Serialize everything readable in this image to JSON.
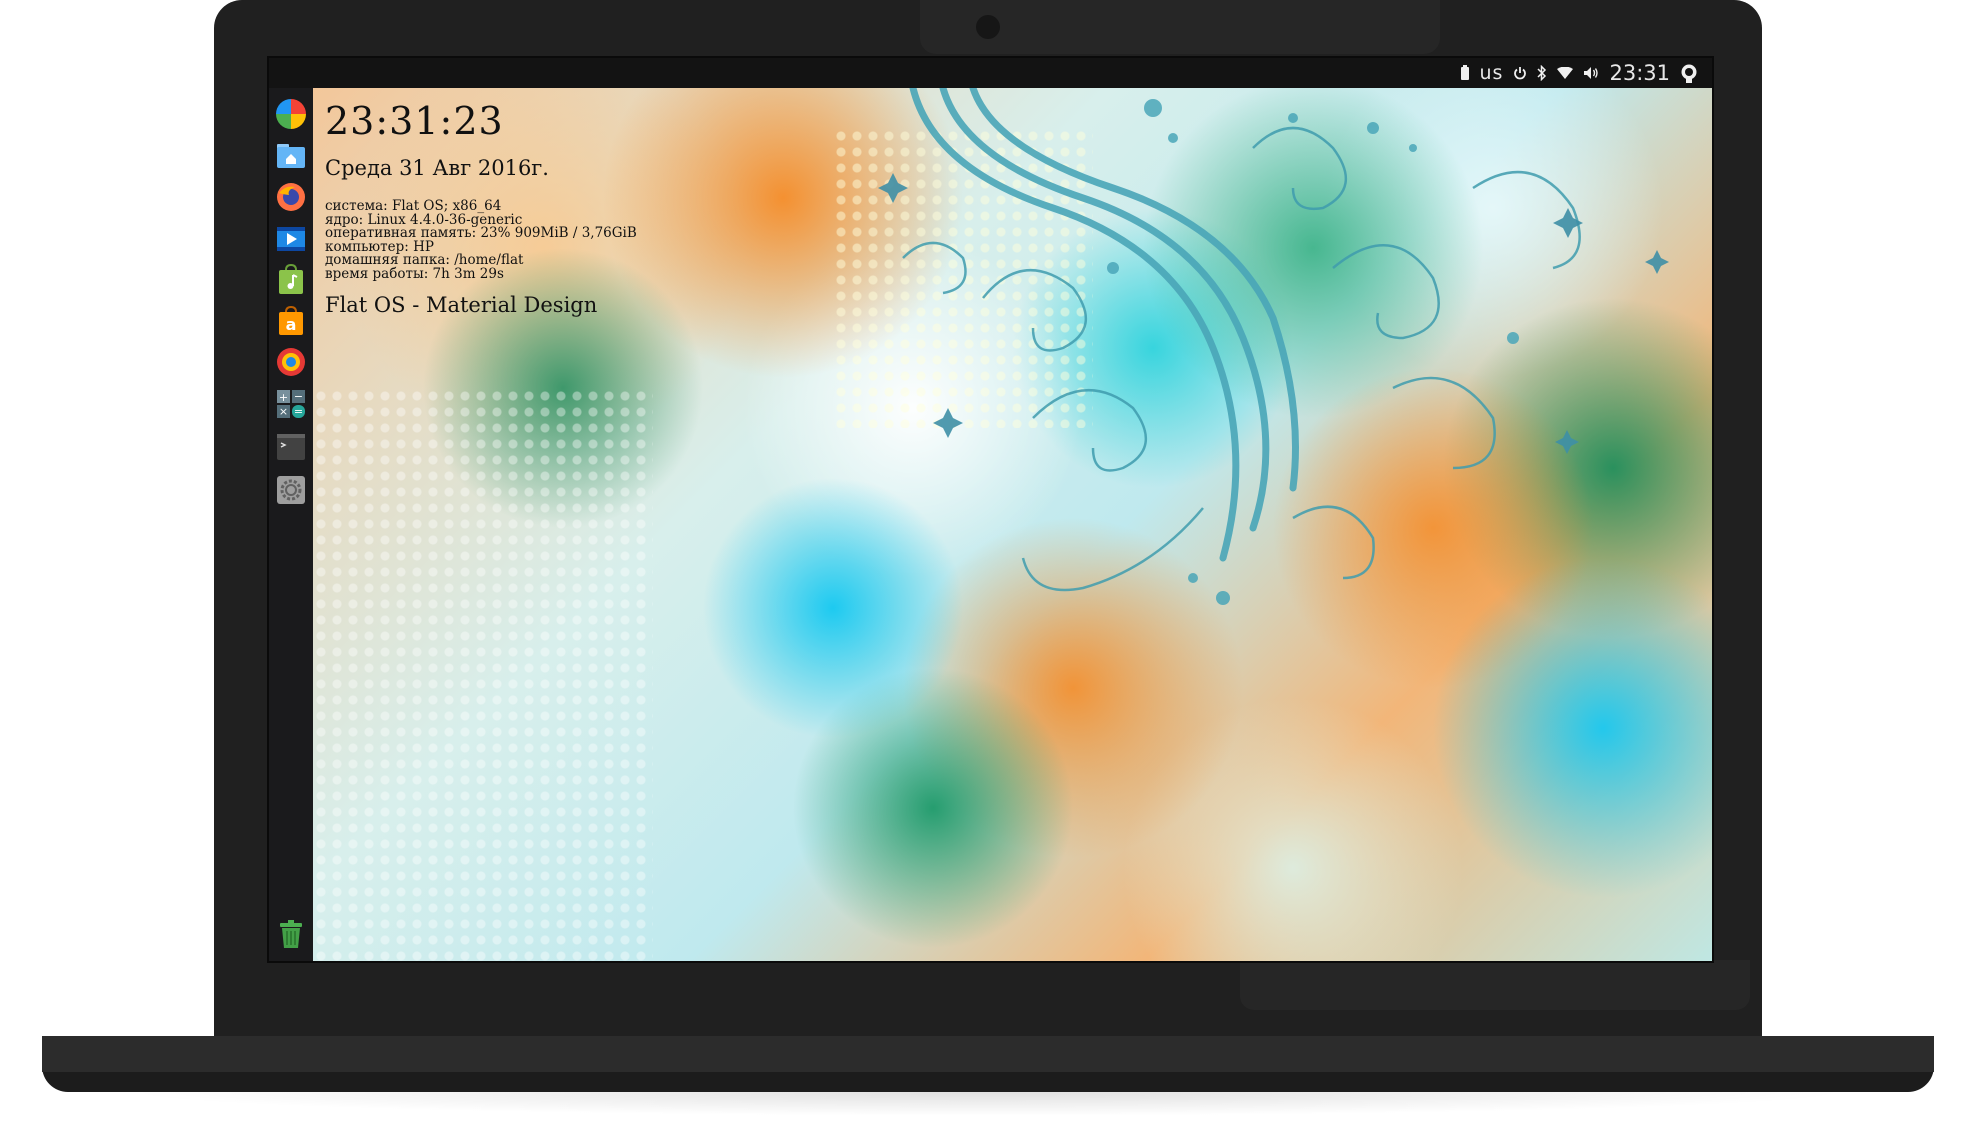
{
  "topbar": {
    "keyboard_layout": "us",
    "clock": "23:31",
    "icons": [
      "battery-icon",
      "power-icon",
      "bluetooth-icon",
      "wifi-icon",
      "volume-icon",
      "user-session-icon"
    ]
  },
  "launcher": {
    "apps": [
      {
        "name": "dash-icon",
        "color": "#2196f3"
      },
      {
        "name": "files-icon",
        "color": "#42a5f5"
      },
      {
        "name": "firefox-icon",
        "color": "#ff6f00"
      },
      {
        "name": "video-player-icon",
        "color": "#1e88e5"
      },
      {
        "name": "music-icon",
        "color": "#8bc34a"
      },
      {
        "name": "amazon-icon",
        "color": "#ff9800"
      },
      {
        "name": "app-center-icon",
        "color": "#f44336"
      },
      {
        "name": "calculator-icon",
        "color": "#607d8b"
      },
      {
        "name": "terminal-icon",
        "color": "#424242"
      },
      {
        "name": "settings-icon",
        "color": "#9e9e9e"
      }
    ],
    "trash": {
      "name": "trash-icon",
      "color": "#4caf50"
    }
  },
  "conky": {
    "time": "23:31:23",
    "date": "Среда 31 Авг 2016г.",
    "info": [
      "система: Flat OS; x86_64",
      "ядро: Linux 4.4.0-36-generic",
      "оперативная память: 23% 909MiB / 3,76GiB",
      "компьютер: HP",
      "домашняя папка: /home/flat",
      "время работы: 7h 3m 29s"
    ],
    "motto": "Flat OS - Material Design"
  }
}
